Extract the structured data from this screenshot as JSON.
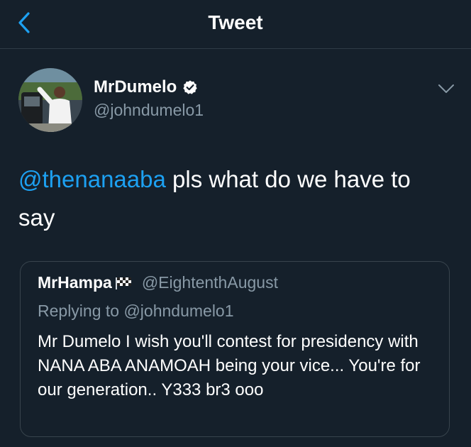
{
  "header": {
    "title": "Tweet",
    "back_icon": "chevron-left-icon"
  },
  "tweet": {
    "display_name": "MrDumelo",
    "handle": "@johndumelo1",
    "verified_icon": "verified-badge-icon",
    "menu_icon": "chevron-down-icon",
    "mention": "@thenanaaba",
    "text": " pls what do we have to say"
  },
  "quoted_tweet": {
    "display_name": "MrHampa",
    "emoji_icon": "checkered-flag-icon",
    "handle": "@EightenthAugust",
    "replying_to": "Replying to @johndumelo1",
    "text": "Mr Dumelo  I wish you'll contest for presidency with NANA ABA ANAMOAH being your vice... You're for our generation.. Y333 br3 ooo"
  },
  "colors": {
    "background": "#15202b",
    "accent": "#1da1f2",
    "secondary_text": "#8899a6",
    "border": "#38444d"
  }
}
